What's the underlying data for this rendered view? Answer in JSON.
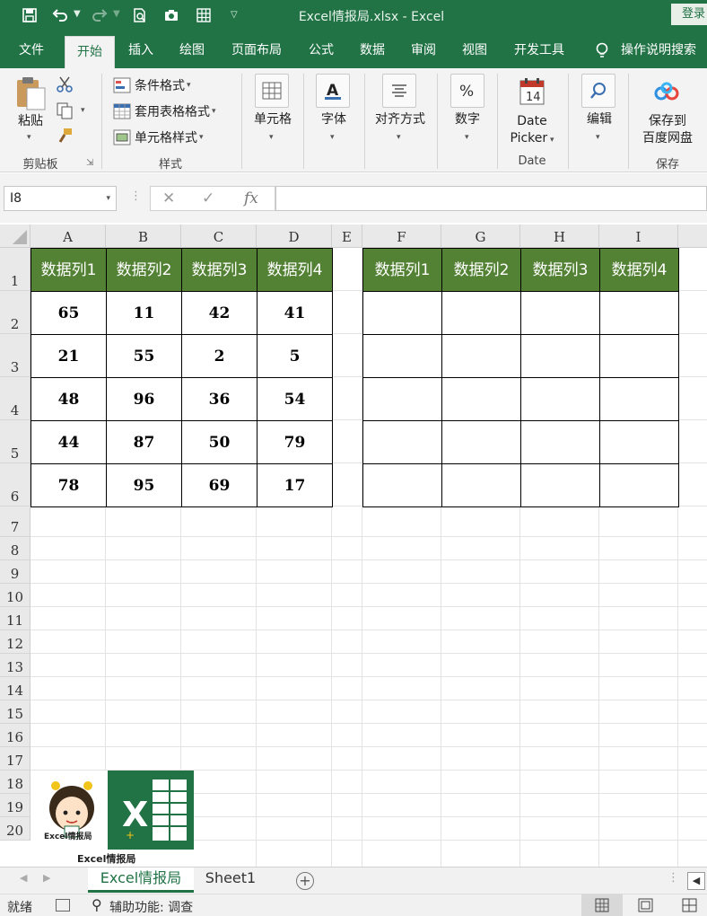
{
  "window": {
    "title": "Excel情报局.xlsx  -  Excel",
    "login": "登录"
  },
  "ribbon_tabs": [
    "文件",
    "开始",
    "插入",
    "绘图",
    "页面布局",
    "公式",
    "数据",
    "审阅",
    "视图",
    "开发工具",
    "操作说明搜索"
  ],
  "ribbon": {
    "paste": "粘贴",
    "clipboard_group": "剪贴板",
    "cond_format": "条件格式",
    "table_format": "套用表格格式",
    "cell_style": "单元格样式",
    "styles_group": "样式",
    "cells": "单元格",
    "font": "字体",
    "align": "对齐方式",
    "number": "数字",
    "date_picker_1": "Date",
    "date_picker_2": "Picker",
    "date_group": "Date",
    "calendar_day": "14",
    "edit": "编辑",
    "save_baidu_1": "保存到",
    "save_baidu_2": "百度网盘",
    "save_group": "保存"
  },
  "formula_bar": {
    "name_box": "I8",
    "fx": "fx",
    "value": ""
  },
  "columns": [
    "A",
    "B",
    "C",
    "D",
    "E",
    "F",
    "G",
    "H",
    "I"
  ],
  "rows": [
    "1",
    "2",
    "3",
    "4",
    "5",
    "6",
    "7",
    "8",
    "9",
    "10",
    "11",
    "12",
    "13",
    "14",
    "15",
    "16",
    "17",
    "18",
    "19",
    "20"
  ],
  "left_table": {
    "headers": [
      "数据列1",
      "数据列2",
      "数据列3",
      "数据列4"
    ],
    "rows": [
      [
        "65",
        "11",
        "42",
        "41"
      ],
      [
        "21",
        "55",
        "2",
        "5"
      ],
      [
        "48",
        "96",
        "36",
        "54"
      ],
      [
        "44",
        "87",
        "50",
        "79"
      ],
      [
        "78",
        "95",
        "69",
        "17"
      ]
    ]
  },
  "right_table": {
    "headers": [
      "数据列1",
      "数据列2",
      "数据列3",
      "数据列4"
    ]
  },
  "logo": {
    "badge": "Excel情报局",
    "caption": "Excel情报局",
    "letter": "X"
  },
  "sheet_tabs": [
    "Excel情报局",
    "Sheet1"
  ],
  "status": {
    "ready": "就绪",
    "accessibility": "辅助功能: 调查"
  },
  "colors": {
    "excel_green": "#217346",
    "header_fill": "#548235"
  }
}
